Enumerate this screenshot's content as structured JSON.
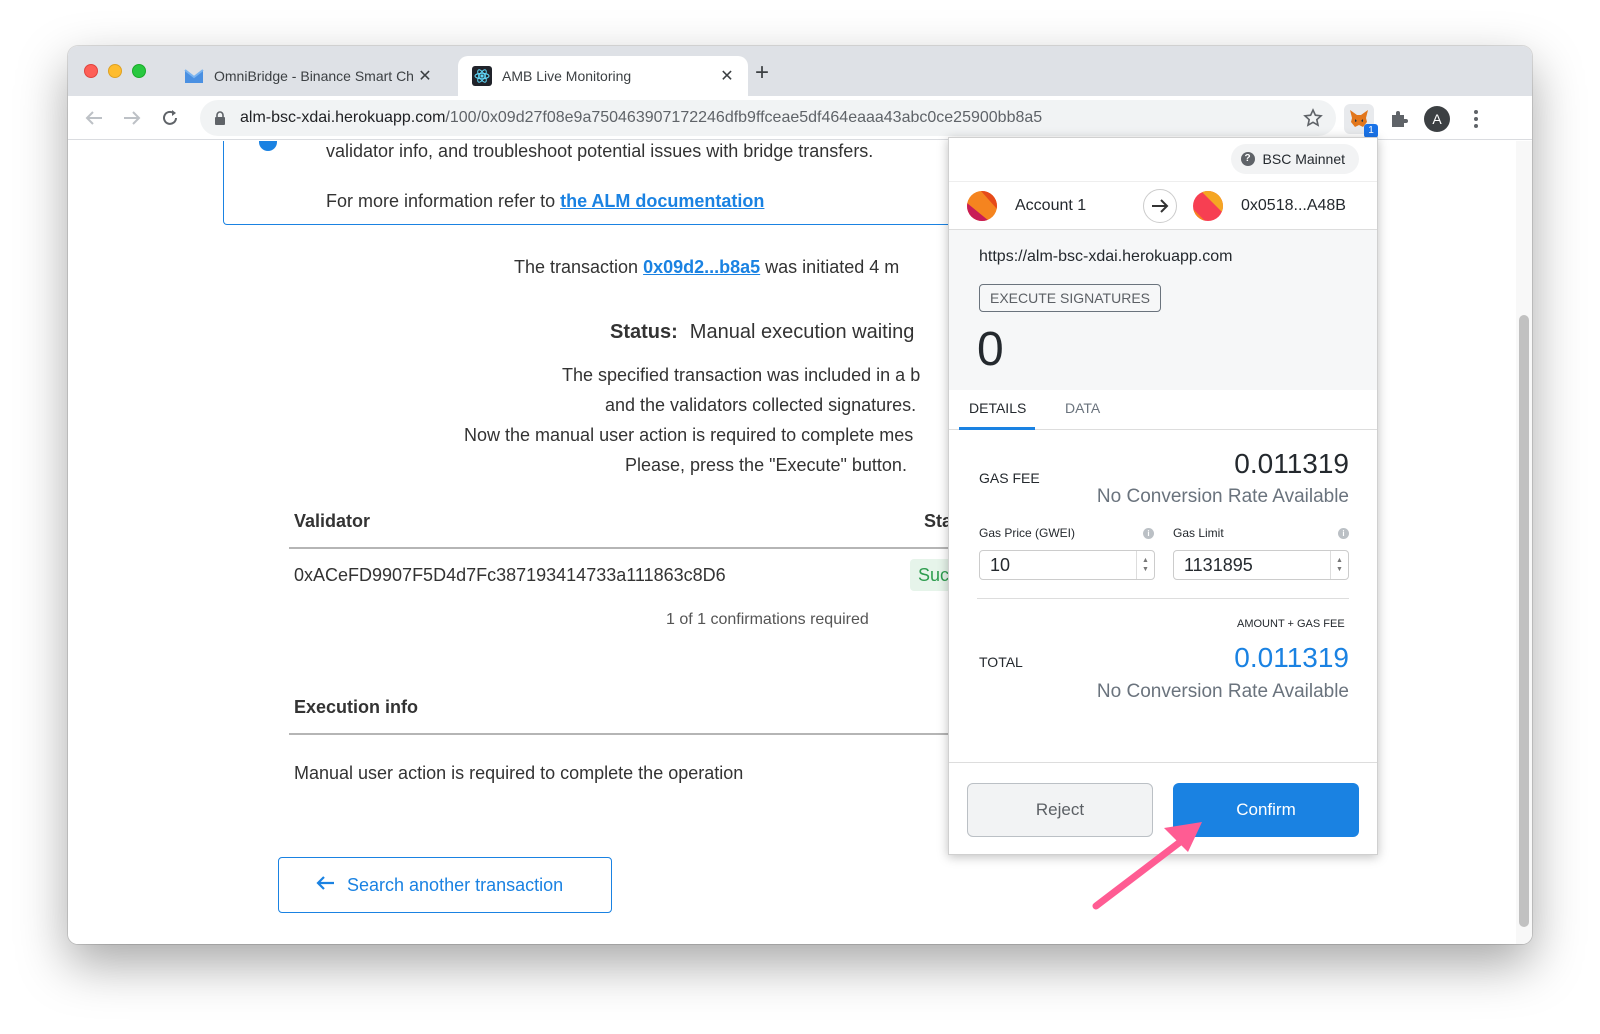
{
  "browser": {
    "tabs": [
      {
        "title": "OmniBridge - Binance Smart Ch",
        "active": false
      },
      {
        "title": "AMB Live Monitoring",
        "active": true
      }
    ],
    "url_host": "alm-bsc-xdai.herokuapp.com",
    "url_path": "/100/0x09d27f08e9a750463907172246dfb9ffceae5df464eaaa43abc0ce25900bb8a5",
    "extension_badge": "1",
    "profile_initial": "A"
  },
  "page": {
    "info_line1": "validator info, and troubleshoot potential issues with bridge transfers.",
    "info_line2_prefix": "For more information refer to ",
    "info_link": "the ALM documentation",
    "tx_prefix": "The transaction ",
    "tx_hash": "0x09d2...b8a5",
    "tx_suffix": " was initiated 4 m",
    "status_label": "Status:",
    "status_value": "Manual execution waiting",
    "desc1": "The specified transaction was included in a b",
    "desc2": "and the validators collected signatures.",
    "desc3": "Now the manual user action is required to complete mes",
    "desc4": "Please, press the \"Execute\" button.",
    "validator_header": "Validator",
    "status_header": "Sta",
    "validator_address": "0xACeFD9907F5D4d7Fc387193414733a111863c8D6",
    "validator_status": "Suc",
    "confirmations_note": "1 of 1 confirmations required",
    "execution_header": "Execution info",
    "execution_text": "Manual user action is required to complete the operation",
    "search_button": "Search another transaction"
  },
  "metamask": {
    "network": "BSC Mainnet",
    "from_account": "Account 1",
    "to_account": "0x0518...A48B",
    "origin": "https://alm-bsc-xdai.herokuapp.com",
    "method": "EXECUTE SIGNATURES",
    "amount": "0",
    "tabs": [
      "DETAILS",
      "DATA"
    ],
    "gas_fee_label": "GAS FEE",
    "gas_fee_value": "0.011319",
    "no_conversion": "No Conversion Rate Available",
    "gas_price_label": "Gas Price (GWEI)",
    "gas_price_value": "10",
    "gas_limit_label": "Gas Limit",
    "gas_limit_value": "1131895",
    "amount_gas_label": "AMOUNT + GAS FEE",
    "total_label": "TOTAL",
    "total_value": "0.011319",
    "reject_label": "Reject",
    "confirm_label": "Confirm",
    "accent_color": "#1a82e2"
  }
}
